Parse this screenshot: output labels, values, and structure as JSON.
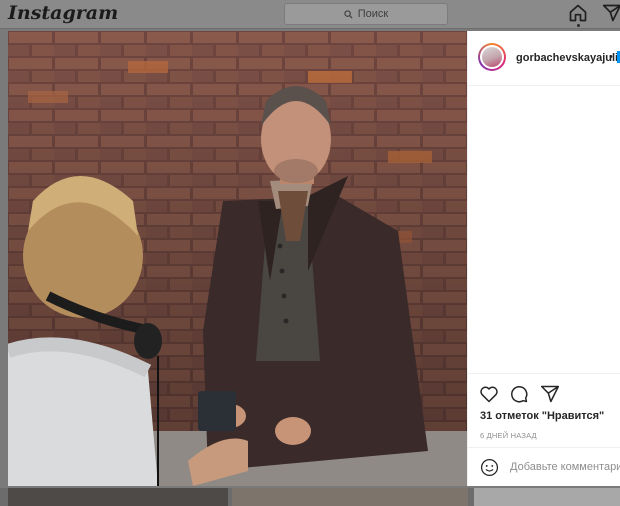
{
  "header": {
    "logo_text": "Instagram",
    "search_placeholder": "Поиск",
    "icons": [
      "home-icon",
      "direct-icon"
    ]
  },
  "post": {
    "username": "gorbachevskayajuli",
    "separator": "•",
    "likes_text": "31 отметок \"Нравится\"",
    "time_text": "6 ДНЕЙ НАЗАД",
    "comment_placeholder": "Добавьте комментарий...",
    "action_icons": [
      "heart-icon",
      "comment-icon",
      "share-icon"
    ]
  },
  "colors": {
    "accent": "#0095f6",
    "text": "#262626",
    "muted": "#8e8e8e",
    "overlay": "#7a7a7a"
  }
}
